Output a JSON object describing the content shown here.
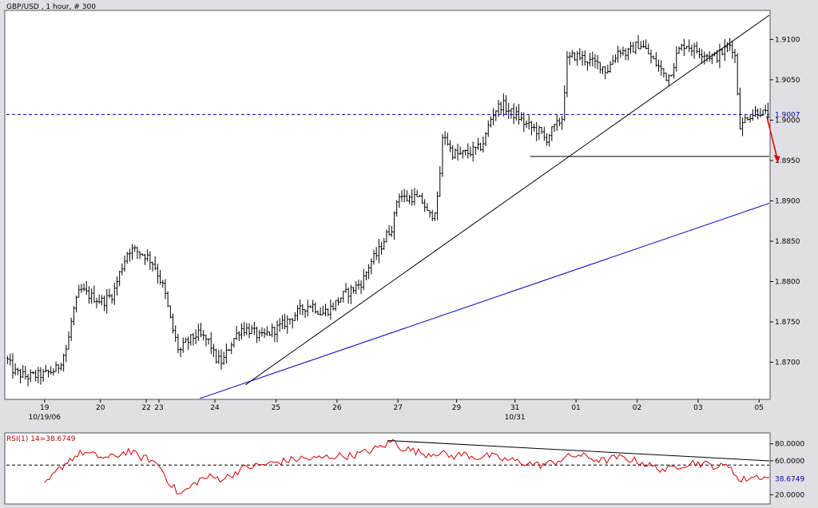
{
  "chart_data": {
    "type": "ohlc",
    "title": "GBP/USD , 1 hour, # 300",
    "price_axis": {
      "ylim": [
        1.8655,
        1.9135
      ],
      "ticks": [
        "1.9100",
        "1.9050",
        "1.9000",
        "1.8950",
        "1.8900",
        "1.8850",
        "1.8800",
        "1.8750",
        "1.8700"
      ],
      "tick_values": [
        1.91,
        1.905,
        1.9,
        1.895,
        1.89,
        1.885,
        1.88,
        1.875,
        1.87
      ]
    },
    "x_axis": {
      "bar_count": 300,
      "labels": [
        {
          "text": "19",
          "bar": 15
        },
        {
          "text": "20",
          "bar": 37
        },
        {
          "text": "22",
          "bar": 55
        },
        {
          "text": "23",
          "bar": 60
        },
        {
          "text": "24",
          "bar": 82
        },
        {
          "text": "25",
          "bar": 106
        },
        {
          "text": "26",
          "bar": 130
        },
        {
          "text": "27",
          "bar": 154
        },
        {
          "text": "29",
          "bar": 177
        },
        {
          "text": "31",
          "bar": 200
        },
        {
          "text": "01",
          "bar": 224
        },
        {
          "text": "02",
          "bar": 248
        },
        {
          "text": "03",
          "bar": 272
        },
        {
          "text": "05",
          "bar": 296
        }
      ],
      "sublabels": [
        {
          "text": "10/19/06",
          "bar": 15
        },
        {
          "text": "10/31",
          "bar": 200
        }
      ]
    },
    "price_path": [
      [
        0,
        1.8705
      ],
      [
        3,
        1.8688
      ],
      [
        8,
        1.8682
      ],
      [
        15,
        1.8685
      ],
      [
        20,
        1.8692
      ],
      [
        24,
        1.872
      ],
      [
        26,
        1.876
      ],
      [
        29,
        1.879
      ],
      [
        33,
        1.8782
      ],
      [
        38,
        1.8775
      ],
      [
        42,
        1.8785
      ],
      [
        45,
        1.8815
      ],
      [
        48,
        1.884
      ],
      [
        51,
        1.8838
      ],
      [
        55,
        1.8832
      ],
      [
        58,
        1.8822
      ],
      [
        62,
        1.879
      ],
      [
        65,
        1.8745
      ],
      [
        68,
        1.8712
      ],
      [
        70,
        1.8722
      ],
      [
        75,
        1.8735
      ],
      [
        80,
        1.8725
      ],
      [
        82,
        1.8705
      ],
      [
        85,
        1.87
      ],
      [
        88,
        1.8722
      ],
      [
        92,
        1.8742
      ],
      [
        96,
        1.874
      ],
      [
        100,
        1.873
      ],
      [
        104,
        1.8738
      ],
      [
        108,
        1.8745
      ],
      [
        112,
        1.8755
      ],
      [
        117,
        1.8768
      ],
      [
        120,
        1.8772
      ],
      [
        124,
        1.876
      ],
      [
        128,
        1.8768
      ],
      [
        132,
        1.8782
      ],
      [
        136,
        1.879
      ],
      [
        140,
        1.88
      ],
      [
        143,
        1.8823
      ],
      [
        146,
        1.8835
      ],
      [
        149,
        1.8855
      ],
      [
        152,
        1.887
      ],
      [
        154,
        1.891
      ],
      [
        157,
        1.8902
      ],
      [
        160,
        1.8905
      ],
      [
        164,
        1.8898
      ],
      [
        166,
        1.888
      ],
      [
        168,
        1.8885
      ],
      [
        170,
        1.8905
      ],
      [
        171,
        1.8965
      ],
      [
        172,
        1.8985
      ],
      [
        175,
        1.896
      ],
      [
        178,
        1.8957
      ],
      [
        182,
        1.896
      ],
      [
        186,
        1.8965
      ],
      [
        188,
        1.8975
      ],
      [
        190,
        1.8998
      ],
      [
        192,
        1.9012
      ],
      [
        195,
        1.902
      ],
      [
        198,
        1.901
      ],
      [
        201,
        1.9005
      ],
      [
        204,
        1.8995
      ],
      [
        207,
        1.899
      ],
      [
        210,
        1.8985
      ],
      [
        212,
        1.8975
      ],
      [
        214,
        1.8985
      ],
      [
        216,
        1.8992
      ],
      [
        219,
        1.9005
      ],
      [
        220,
        1.9072
      ],
      [
        223,
        1.908
      ],
      [
        226,
        1.9078
      ],
      [
        230,
        1.9072
      ],
      [
        234,
        1.9068
      ],
      [
        236,
        1.906
      ],
      [
        238,
        1.9072
      ],
      [
        241,
        1.9088
      ],
      [
        244,
        1.9082
      ],
      [
        246,
        1.9088
      ],
      [
        249,
        1.9095
      ],
      [
        252,
        1.9085
      ],
      [
        254,
        1.9075
      ],
      [
        256,
        1.9068
      ],
      [
        258,
        1.906
      ],
      [
        260,
        1.9052
      ],
      [
        262,
        1.9065
      ],
      [
        264,
        1.9085
      ],
      [
        267,
        1.9095
      ],
      [
        270,
        1.9088
      ],
      [
        273,
        1.9085
      ],
      [
        276,
        1.908
      ],
      [
        279,
        1.9078
      ],
      [
        282,
        1.9085
      ],
      [
        284,
        1.9095
      ],
      [
        286,
        1.9088
      ],
      [
        287,
        1.907
      ],
      [
        288,
        1.9
      ],
      [
        289,
        1.899
      ],
      [
        291,
        1.9005
      ],
      [
        293,
        1.9007
      ],
      [
        296,
        1.9012
      ],
      [
        298,
        1.9007
      ],
      [
        300,
        1.9007
      ]
    ],
    "current_price": {
      "value": 1.9007,
      "label": "1.9007"
    },
    "horizontal_support": {
      "value": 1.8955,
      "bar_start": 206
    },
    "trendlines": [
      {
        "from": [
          94,
          1.8672
        ],
        "to": [
          300,
          1.913
        ],
        "color": "#000000"
      },
      {
        "from": [
          76,
          1.8655
        ],
        "to": [
          300,
          1.8897
        ],
        "color": "#0000c0"
      }
    ],
    "projection_arrow": {
      "from": [
        299,
        1.9005
      ],
      "to": [
        303,
        1.895
      ],
      "color": "#e00000"
    },
    "rsi": {
      "label": "RSI(1) 14=38.6749",
      "period": 14,
      "current": 38.6749,
      "current_label": "38.6749",
      "ylim": [
        10,
        92
      ],
      "ticks": [
        "80.0000",
        "60.0000",
        "20.0000"
      ],
      "tick_values": [
        80,
        60,
        20
      ],
      "reference_level": 55,
      "path": [
        [
          15,
          30
        ],
        [
          20,
          48
        ],
        [
          25,
          62
        ],
        [
          30,
          70
        ],
        [
          35,
          66
        ],
        [
          40,
          63
        ],
        [
          45,
          68
        ],
        [
          48,
          72
        ],
        [
          52,
          65
        ],
        [
          56,
          62
        ],
        [
          60,
          55
        ],
        [
          64,
          35
        ],
        [
          68,
          20
        ],
        [
          72,
          28
        ],
        [
          76,
          38
        ],
        [
          80,
          41
        ],
        [
          84,
          39
        ],
        [
          88,
          42
        ],
        [
          92,
          50
        ],
        [
          96,
          53
        ],
        [
          100,
          55
        ],
        [
          104,
          57
        ],
        [
          108,
          59
        ],
        [
          112,
          61
        ],
        [
          116,
          63
        ],
        [
          120,
          62
        ],
        [
          125,
          64
        ],
        [
          130,
          66
        ],
        [
          135,
          66
        ],
        [
          140,
          69
        ],
        [
          145,
          74
        ],
        [
          150,
          80
        ],
        [
          152,
          84
        ],
        [
          155,
          76
        ],
        [
          160,
          72
        ],
        [
          165,
          68
        ],
        [
          170,
          70
        ],
        [
          175,
          65
        ],
        [
          180,
          68
        ],
        [
          185,
          64
        ],
        [
          190,
          66
        ],
        [
          195,
          62
        ],
        [
          200,
          60
        ],
        [
          205,
          57
        ],
        [
          210,
          55
        ],
        [
          215,
          58
        ],
        [
          220,
          64
        ],
        [
          225,
          67
        ],
        [
          230,
          63
        ],
        [
          235,
          60
        ],
        [
          240,
          64
        ],
        [
          245,
          62
        ],
        [
          250,
          58
        ],
        [
          255,
          52
        ],
        [
          260,
          49
        ],
        [
          265,
          55
        ],
        [
          270,
          58
        ],
        [
          275,
          56
        ],
        [
          280,
          53
        ],
        [
          285,
          54
        ],
        [
          288,
          36
        ],
        [
          292,
          40
        ],
        [
          296,
          42
        ],
        [
          300,
          39
        ]
      ],
      "trendline": {
        "from": [
          150,
          84
        ],
        "to": [
          300,
          60
        ],
        "color": "#000000"
      }
    }
  }
}
